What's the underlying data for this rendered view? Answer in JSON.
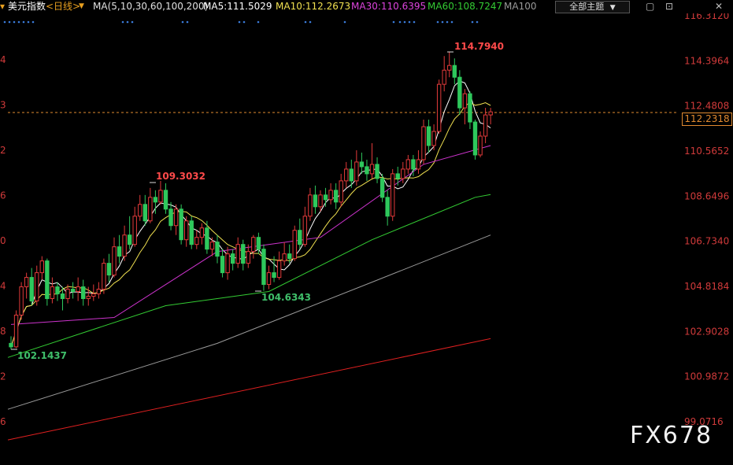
{
  "header": {
    "title": "美元指数",
    "period": "<日线>",
    "ma_spec": "MA(5,10,30,60,100,200)",
    "ma5": "MA5:111.5029",
    "ma10": "MA10:112.2673",
    "ma30": "MA30:110.6395",
    "ma60": "MA60:108.7247",
    "ma100": "MA100",
    "theme_button": "全部主题",
    "dropdown_icon": "▼",
    "window_controls": [
      "▢",
      "⊡",
      "✕"
    ]
  },
  "colors": {
    "up": "#e23a3a",
    "down": "#2ec85c",
    "ma5": "#ffffff",
    "ma10": "#f0e050",
    "ma30": "#cc33cc",
    "ma60": "#33cc33",
    "ma100": "#999999",
    "ma200": "#e02020",
    "price_line": "#e08a30"
  },
  "price_tag": "112.2318",
  "watermark": "FX678",
  "chart_data": {
    "type": "candlestick",
    "y_axis_labels": [
      "116.3120",
      "114.3964",
      "112.4808",
      "110.5652",
      "108.6496",
      "106.7340",
      "104.8184",
      "102.9028",
      "100.9872",
      "99.0716"
    ],
    "ylim": [
      99.0716,
      116.312
    ],
    "left_tick_labels": [
      "4",
      "3",
      "2",
      "6",
      "0",
      "4",
      "8",
      "2",
      "6"
    ],
    "annotations": [
      {
        "label": "114.7940",
        "kind": "high"
      },
      {
        "label": "109.3032",
        "kind": "high"
      },
      {
        "label": "104.6343",
        "kind": "low"
      },
      {
        "label": "102.1437",
        "kind": "low"
      }
    ],
    "current_price": 112.2318,
    "candles": [
      [
        102.4,
        102.25,
        102.7,
        102.14
      ],
      [
        102.25,
        103.6,
        103.8,
        102.2
      ],
      [
        103.6,
        104.8,
        105.0,
        103.4
      ],
      [
        104.8,
        105.2,
        105.4,
        104.3
      ],
      [
        105.2,
        104.2,
        105.6,
        104.0
      ],
      [
        104.2,
        105.4,
        105.7,
        104.0
      ],
      [
        105.4,
        105.9,
        106.1,
        105.1
      ],
      [
        105.9,
        104.3,
        106.0,
        104.0
      ],
      [
        104.3,
        104.8,
        105.2,
        104.1
      ],
      [
        104.8,
        104.5,
        105.0,
        104.2
      ],
      [
        104.5,
        104.3,
        104.8,
        103.8
      ],
      [
        104.3,
        104.7,
        104.9,
        104.1
      ],
      [
        104.7,
        104.6,
        105.0,
        104.3
      ],
      [
        104.6,
        104.8,
        105.2,
        104.2
      ],
      [
        104.8,
        104.3,
        105.1,
        104.0
      ],
      [
        104.3,
        104.4,
        104.8,
        104.0
      ],
      [
        104.4,
        104.5,
        104.9,
        104.2
      ],
      [
        104.5,
        104.7,
        105.0,
        104.3
      ],
      [
        104.7,
        105.8,
        106.0,
        104.5
      ],
      [
        105.8,
        105.3,
        106.2,
        105.0
      ],
      [
        105.3,
        106.5,
        106.9,
        105.2
      ],
      [
        106.5,
        106.1,
        107.0,
        105.8
      ],
      [
        106.1,
        107.0,
        107.4,
        105.9
      ],
      [
        107.0,
        106.6,
        107.8,
        106.4
      ],
      [
        106.6,
        107.8,
        108.2,
        106.5
      ],
      [
        107.8,
        108.3,
        108.7,
        107.6
      ],
      [
        108.3,
        107.6,
        108.7,
        107.4
      ],
      [
        107.6,
        108.6,
        109.0,
        107.5
      ],
      [
        108.6,
        108.4,
        108.9,
        107.9
      ],
      [
        108.4,
        108.9,
        109.3,
        108.3
      ],
      [
        108.9,
        108.1,
        109.2,
        107.9
      ],
      [
        108.1,
        107.4,
        108.4,
        107.2
      ],
      [
        107.4,
        108.1,
        108.3,
        107.0
      ],
      [
        108.1,
        106.8,
        108.3,
        106.6
      ],
      [
        106.8,
        107.6,
        107.8,
        106.5
      ],
      [
        107.6,
        106.6,
        107.8,
        106.4
      ],
      [
        106.6,
        106.9,
        107.2,
        106.4
      ],
      [
        106.9,
        107.3,
        107.5,
        106.6
      ],
      [
        107.3,
        106.4,
        107.6,
        106.2
      ],
      [
        106.4,
        106.7,
        106.9,
        106.1
      ],
      [
        106.7,
        106.1,
        107.0,
        105.8
      ],
      [
        106.1,
        105.4,
        106.4,
        105.2
      ],
      [
        105.4,
        106.2,
        106.5,
        105.1
      ],
      [
        106.2,
        105.8,
        106.4,
        105.5
      ],
      [
        105.8,
        106.6,
        106.9,
        105.6
      ],
      [
        106.6,
        105.8,
        106.8,
        105.5
      ],
      [
        105.8,
        106.3,
        106.6,
        105.6
      ],
      [
        106.3,
        106.9,
        107.0,
        106.0
      ],
      [
        106.9,
        106.4,
        107.1,
        106.2
      ],
      [
        106.4,
        104.9,
        106.6,
        104.63
      ],
      [
        104.9,
        105.4,
        105.7,
        104.7
      ],
      [
        105.4,
        105.2,
        106.1,
        105.0
      ],
      [
        105.2,
        105.9,
        106.3,
        105.1
      ],
      [
        105.9,
        106.2,
        106.7,
        105.7
      ],
      [
        106.2,
        106.0,
        106.6,
        105.8
      ],
      [
        106.0,
        107.2,
        107.4,
        105.9
      ],
      [
        107.2,
        106.6,
        107.7,
        106.4
      ],
      [
        106.6,
        107.8,
        108.2,
        106.5
      ],
      [
        107.8,
        108.7,
        109.0,
        107.6
      ],
      [
        108.7,
        108.2,
        109.1,
        107.9
      ],
      [
        108.2,
        108.7,
        108.9,
        108.0
      ],
      [
        108.7,
        108.5,
        109.0,
        108.2
      ],
      [
        108.5,
        108.9,
        109.2,
        108.3
      ],
      [
        108.9,
        108.4,
        109.2,
        108.1
      ],
      [
        108.4,
        109.3,
        109.6,
        108.2
      ],
      [
        109.3,
        109.8,
        110.1,
        109.0
      ],
      [
        109.8,
        109.3,
        110.2,
        109.0
      ],
      [
        109.3,
        110.1,
        110.6,
        109.1
      ],
      [
        110.1,
        109.9,
        110.5,
        109.6
      ],
      [
        109.9,
        109.6,
        110.2,
        109.3
      ],
      [
        109.6,
        110.0,
        110.9,
        109.4
      ],
      [
        110.0,
        109.4,
        110.3,
        109.2
      ],
      [
        109.4,
        108.6,
        109.6,
        108.4
      ],
      [
        108.6,
        107.8,
        108.9,
        107.4
      ],
      [
        107.8,
        109.6,
        109.8,
        107.6
      ],
      [
        109.6,
        109.4,
        109.9,
        109.1
      ],
      [
        109.4,
        109.8,
        110.1,
        109.2
      ],
      [
        109.8,
        110.2,
        110.4,
        109.6
      ],
      [
        110.2,
        109.8,
        110.4,
        109.5
      ],
      [
        109.8,
        110.2,
        110.6,
        109.6
      ],
      [
        110.2,
        111.6,
        111.9,
        110.0
      ],
      [
        111.6,
        110.8,
        111.9,
        110.5
      ],
      [
        110.8,
        111.4,
        111.7,
        110.6
      ],
      [
        111.4,
        113.4,
        113.6,
        111.3
      ],
      [
        113.4,
        114.0,
        114.6,
        113.1
      ],
      [
        114.0,
        114.2,
        114.79,
        113.7
      ],
      [
        114.2,
        113.7,
        114.5,
        113.4
      ],
      [
        113.7,
        112.4,
        114.0,
        112.1
      ],
      [
        112.4,
        113.0,
        113.2,
        111.7
      ],
      [
        113.0,
        111.8,
        113.1,
        111.5
      ],
      [
        111.8,
        110.4,
        111.9,
        110.2
      ],
      [
        110.4,
        111.2,
        111.4,
        110.3
      ],
      [
        111.2,
        112.1,
        112.4,
        110.9
      ],
      [
        112.1,
        112.23,
        112.4,
        111.7
      ]
    ],
    "ma_lines": {
      "ma30": [
        [
          0,
          103.2
        ],
        [
          20,
          103.5
        ],
        [
          40,
          106.3
        ],
        [
          60,
          106.9
        ],
        [
          80,
          110.0
        ],
        [
          93,
          110.8
        ]
      ],
      "ma60": [
        [
          0,
          101.8
        ],
        [
          30,
          104.0
        ],
        [
          50,
          104.6
        ],
        [
          70,
          106.8
        ],
        [
          90,
          108.6
        ],
        [
          93,
          108.72
        ]
      ],
      "ma100": [
        [
          0,
          99.6
        ],
        [
          40,
          102.4
        ],
        [
          70,
          105.0
        ],
        [
          93,
          107.0
        ]
      ],
      "ma200": [
        [
          0,
          98.3
        ],
        [
          93,
          102.6
        ]
      ]
    }
  }
}
